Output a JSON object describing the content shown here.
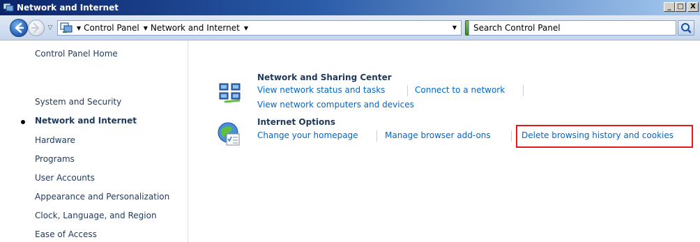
{
  "window": {
    "title": "Network and Internet",
    "controls": {
      "minimize": "_",
      "maximize": "□",
      "close": "X"
    }
  },
  "address_bar": {
    "crumbs": [
      "Control Panel",
      "Network and Internet"
    ],
    "search_placeholder": "Search Control Panel"
  },
  "sidebar": {
    "items": [
      {
        "label": "Control Panel Home",
        "current": false
      },
      {
        "label": "System and Security",
        "current": false
      },
      {
        "label": "Network and Internet",
        "current": true
      },
      {
        "label": "Hardware",
        "current": false
      },
      {
        "label": "Programs",
        "current": false
      },
      {
        "label": "User Accounts",
        "current": false
      },
      {
        "label": "Appearance and Personalization",
        "current": false
      },
      {
        "label": "Clock, Language, and Region",
        "current": false
      },
      {
        "label": "Ease of Access",
        "current": false
      }
    ]
  },
  "sections": [
    {
      "title": "Network and Sharing Center",
      "icon": "network-icon",
      "tasks": [
        "View network status and tasks",
        "Connect to a network",
        "View network computers and devices"
      ]
    },
    {
      "title": "Internet Options",
      "icon": "internet-options-icon",
      "tasks": [
        "Change your homepage",
        "Manage browser add-ons",
        "Delete browsing history and cookies"
      ]
    }
  ],
  "colors": {
    "highlight": "#e11b1b",
    "link": "#0066cc",
    "title_bar": "#0a246a"
  }
}
